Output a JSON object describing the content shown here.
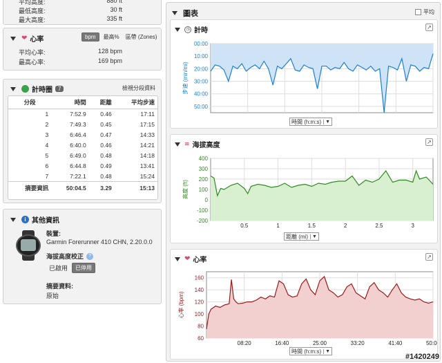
{
  "elevation_top": {
    "rows": [
      {
        "label": "平均高度:",
        "value": "880 ft"
      },
      {
        "label": "最低高度:",
        "value": "30 ft"
      },
      {
        "label": "最大高度:",
        "value": "335 ft"
      }
    ]
  },
  "heart_panel": {
    "title": "心率",
    "tabs": [
      "bpm",
      "最高%",
      "區帶 (Zones)"
    ],
    "rows": [
      {
        "label": "平均心率:",
        "value": "128 bpm"
      },
      {
        "label": "最高心率:",
        "value": "169 bpm"
      }
    ]
  },
  "laps_panel": {
    "title": "計時圈",
    "count": "7",
    "link": "檢視分段資料",
    "headers": [
      "分段",
      "時間",
      "距離",
      "平均步速"
    ],
    "rows": [
      [
        "1",
        "7:52.9",
        "0.46",
        "17:11"
      ],
      [
        "2",
        "7:49.3",
        "0.45",
        "17:15"
      ],
      [
        "3",
        "6:46.4",
        "0.47",
        "14:33"
      ],
      [
        "4",
        "6:40.0",
        "0.46",
        "14:21"
      ],
      [
        "5",
        "6:49.0",
        "0.48",
        "14:18"
      ],
      [
        "6",
        "6:44.8",
        "0.49",
        "13:41"
      ],
      [
        "7",
        "7:22.1",
        "0.48",
        "15:24"
      ]
    ],
    "summary": [
      "摘要資訊",
      "50:04.5",
      "3.29",
      "15:13"
    ]
  },
  "info_panel": {
    "title": "其他資訊",
    "device_label": "裝置:",
    "device_value": "Garmin Forerunner 410 CHN, 2.20.0.0",
    "elev_corr_label": "海拔高度校正",
    "enabled": "已啟用",
    "disabled": "已停用",
    "summary_label": "摘要資料:",
    "summary_value": "原始"
  },
  "charts_panel": {
    "title": "圖表",
    "avg_label": "平均"
  },
  "watermark": "#1420249",
  "colors": {
    "pace": "#1a7fd4",
    "pace_fill": "#cfe3f7",
    "elev": "#2f8a1e",
    "elev_fill": "#d8efd0",
    "hr": "#9a1a1a",
    "hr_fill": "#f2d0d0"
  },
  "chart_data": [
    {
      "type": "area",
      "title": "計時",
      "ylabel": "步速 (min/mi)",
      "xlabel": "時間 (h:m:s)",
      "x_ticks": [
        "08:20",
        "16:40",
        "25:00",
        "33:20",
        "41:40",
        "50:00"
      ],
      "y_ticks": [
        "00:00",
        "10:00",
        "20:00",
        "30:00",
        "40:00",
        "50:00"
      ],
      "ylim": [
        0,
        55
      ],
      "y_inverted": true,
      "xlim": [
        0,
        50
      ],
      "x": [
        0,
        1,
        2,
        3,
        4,
        5,
        6,
        7,
        8,
        9,
        10,
        11,
        12,
        13,
        14,
        15,
        16,
        17,
        18,
        19,
        20,
        21,
        22,
        23,
        24,
        25,
        26,
        27,
        28,
        29,
        30,
        31,
        32,
        33,
        34,
        35,
        36,
        37,
        38,
        39,
        40,
        41,
        42,
        43,
        44,
        45,
        46,
        47,
        48,
        49,
        50
      ],
      "values": [
        22,
        17,
        18,
        21,
        30,
        18,
        20,
        16,
        22,
        19,
        17,
        20,
        14,
        20,
        33,
        18,
        20,
        16,
        12,
        21,
        22,
        17,
        19,
        20,
        36,
        18,
        18,
        21,
        19,
        20,
        15,
        20,
        22,
        17,
        19,
        21,
        18,
        22,
        20,
        56,
        18,
        19,
        21,
        12,
        30,
        17,
        18,
        22,
        19,
        20,
        8
      ]
    },
    {
      "type": "area",
      "title": "海拔高度",
      "ylabel": "高度 (ft)",
      "xlabel": "距離 (mi)",
      "x_ticks": [
        "0.5",
        "1",
        "1.5",
        "2",
        "2.5",
        "3"
      ],
      "y_ticks": [
        "400",
        "300",
        "200",
        "100",
        "0",
        "-100",
        "-200"
      ],
      "ylim": [
        -200,
        400
      ],
      "xlim": [
        0,
        3.3
      ],
      "x": [
        0,
        0.05,
        0.1,
        0.15,
        0.2,
        0.3,
        0.4,
        0.5,
        0.55,
        0.6,
        0.7,
        0.8,
        0.9,
        1.0,
        1.1,
        1.2,
        1.3,
        1.4,
        1.5,
        1.6,
        1.7,
        1.8,
        1.9,
        2.0,
        2.1,
        2.2,
        2.3,
        2.4,
        2.5,
        2.6,
        2.7,
        2.8,
        2.9,
        3.0,
        3.05,
        3.1,
        3.2,
        3.3
      ],
      "values": [
        230,
        210,
        40,
        110,
        100,
        140,
        160,
        110,
        60,
        130,
        150,
        140,
        120,
        130,
        160,
        120,
        140,
        150,
        130,
        160,
        150,
        170,
        180,
        180,
        230,
        140,
        190,
        170,
        200,
        280,
        170,
        190,
        190,
        170,
        280,
        200,
        220,
        150
      ]
    },
    {
      "type": "area",
      "title": "心率",
      "ylabel": "心率 (bpm)",
      "xlabel": "時間 (h:m:s)",
      "x_ticks": [
        "08:20",
        "16:40",
        "25:00",
        "33:20",
        "41:40",
        "50:00"
      ],
      "y_ticks": [
        "160",
        "140",
        "120",
        "100",
        "80",
        "60"
      ],
      "ylim": [
        60,
        170
      ],
      "xlim": [
        0,
        50
      ],
      "x": [
        0,
        0.5,
        1,
        2,
        3,
        4,
        5,
        5.5,
        6,
        6.5,
        7,
        8,
        9,
        10,
        11,
        12,
        13,
        14,
        15,
        16,
        17,
        18,
        19,
        20,
        21,
        22,
        23,
        24,
        25,
        26,
        27,
        28,
        29,
        30,
        31,
        32,
        33,
        34,
        35,
        36,
        37,
        38,
        39,
        40,
        41,
        42,
        43,
        44,
        45,
        46,
        47,
        48,
        49,
        50
      ],
      "values": [
        75,
        100,
        108,
        113,
        111,
        115,
        117,
        157,
        125,
        120,
        117,
        118,
        120,
        120,
        123,
        128,
        125,
        130,
        128,
        155,
        150,
        132,
        128,
        130,
        150,
        158,
        140,
        132,
        155,
        162,
        140,
        135,
        128,
        132,
        145,
        150,
        135,
        130,
        125,
        145,
        152,
        140,
        135,
        128,
        140,
        150,
        135,
        128,
        125,
        123,
        125,
        120,
        118,
        120
      ]
    }
  ]
}
